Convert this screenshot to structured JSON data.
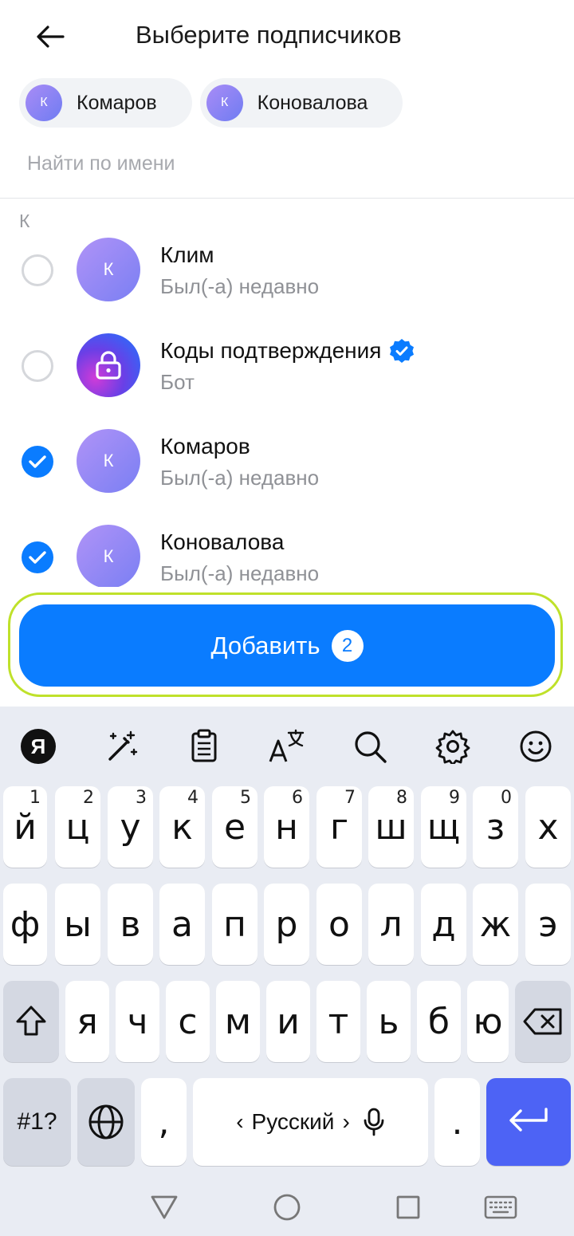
{
  "header": {
    "title": "Выберите подписчиков"
  },
  "chips": [
    {
      "initial": "К",
      "label": "Комаров"
    },
    {
      "initial": "К",
      "label": "Коновалова"
    }
  ],
  "search": {
    "placeholder": "Найти по имени"
  },
  "list": {
    "section_letter": "К",
    "contacts": [
      {
        "initial": "К",
        "name": "Клим",
        "status": "Был(-а) недавно",
        "checked": false
      },
      {
        "initial": "",
        "name": "Коды подтверждения",
        "status": "Бот",
        "checked": false,
        "verified": true,
        "avatar_icon": "lock-icon"
      },
      {
        "initial": "К",
        "name": "Комаров",
        "status": "Был(-а) недавно",
        "checked": true
      },
      {
        "initial": "К",
        "name": "Коновалова",
        "status": "Был(-а) недавно",
        "checked": true
      }
    ]
  },
  "add_button": {
    "label": "Добавить",
    "count": "2"
  },
  "keyboard": {
    "row1": [
      {
        "k": "й",
        "h": "1"
      },
      {
        "k": "ц",
        "h": "2"
      },
      {
        "k": "у",
        "h": "3"
      },
      {
        "k": "к",
        "h": "4"
      },
      {
        "k": "е",
        "h": "5"
      },
      {
        "k": "н",
        "h": "6"
      },
      {
        "k": "г",
        "h": "7"
      },
      {
        "k": "ш",
        "h": "8"
      },
      {
        "k": "щ",
        "h": "9"
      },
      {
        "k": "з",
        "h": "0"
      },
      {
        "k": "х",
        "h": ""
      }
    ],
    "row2": [
      "ф",
      "ы",
      "в",
      "а",
      "п",
      "р",
      "о",
      "л",
      "д",
      "ж",
      "э"
    ],
    "row3": [
      "я",
      "ч",
      "с",
      "м",
      "и",
      "т",
      "ь",
      "б",
      "ю"
    ],
    "symbols_label": "#1?",
    "comma": ",",
    "period": ".",
    "space_label": "Русский",
    "space_left": "‹",
    "space_right": "›",
    "yandex_label": "Я"
  },
  "colors": {
    "accent": "#0a7cff",
    "highlight": "#bfe12a",
    "enter": "#4d63f5"
  }
}
